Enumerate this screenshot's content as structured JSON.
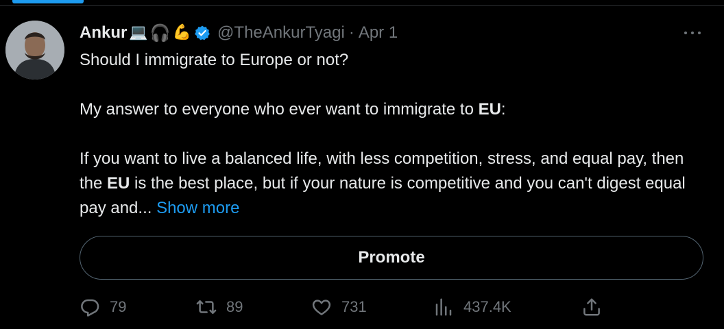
{
  "tweet": {
    "author_name": "Ankur",
    "author_emojis": [
      "💻",
      "🎧",
      "💪"
    ],
    "handle": "@TheAnkurTyagi",
    "separator": "·",
    "date": "Apr 1",
    "text": {
      "line1": "Should I immigrate to Europe or not?",
      "p2_prefix": "My answer to everyone who ever want to immigrate to ",
      "p2_bold": "EU",
      "p2_suffix": ":",
      "p3_part1": "If you want to live a balanced life, with less competition, stress, and equal pay, then the ",
      "p3_bold": "EU",
      "p3_part2": " is the best place, but if your nature is competitive and you can't digest equal pay and... ",
      "show_more": "Show more"
    },
    "promote_label": "Promote",
    "actions": {
      "replies": "79",
      "retweets": "89",
      "likes": "731",
      "views": "437.4K"
    }
  },
  "icons": {
    "verified": "verified-badge-icon",
    "more": "more-options-icon",
    "reply": "reply-icon",
    "retweet": "retweet-icon",
    "like": "heart-icon",
    "views": "analytics-icon",
    "share": "share-icon"
  },
  "colors": {
    "background": "#000000",
    "text": "#e7e9ea",
    "muted": "#71767b",
    "accent": "#1d9bf0",
    "border": "#536471"
  }
}
